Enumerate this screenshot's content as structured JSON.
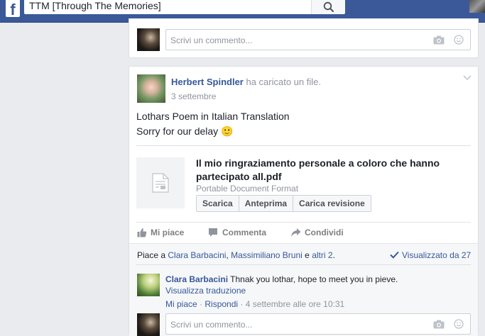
{
  "header": {
    "logo": "f",
    "search_value": "TTM [Through The Memories]",
    "search_icon": "search-icon"
  },
  "top_comment": {
    "placeholder": "Scrivi un commento...",
    "icons": [
      "camera-icon",
      "smiley-icon"
    ]
  },
  "post": {
    "author": "Herbert Spindler",
    "action": "ha caricato un file.",
    "date": "3 settembre",
    "text_line1": "Lothars Poem in Italian Translation",
    "text_line2": "Sorry for our delay",
    "emoji": "🙂",
    "attachment": {
      "title": "Il mio ringraziamento personale a coloro che hanno partecipato all.pdf",
      "type": "Portable Document Format",
      "buttons": [
        "Scarica",
        "Anteprima",
        "Carica revisione"
      ]
    },
    "actions": {
      "like": "Mi piace",
      "comment": "Commenta",
      "share": "Condividi"
    }
  },
  "social": {
    "likes_prefix": "Piace a",
    "liker1": "Clara Barbacini",
    "sep1": ",",
    "liker2": "Massimiliano Bruni",
    "sep2": "e",
    "liker3": "altri 2",
    "end": ".",
    "seen": "Visualizzato da 27"
  },
  "comment": {
    "author": "Clara Barbacini",
    "text": "Thnak you lothar, hope to meet you in pieve.",
    "translate": "Visualizza traduzione",
    "like": "Mi piace",
    "dot1": "·",
    "reply": "Rispondi",
    "dot2": "·",
    "time": "4 settembre alle ore 10:31"
  },
  "bottom_comment": {
    "placeholder": "Scrivi un commento..."
  },
  "colors": {
    "brand": "#3b5998",
    "link": "#365899",
    "background": "#e9ebee"
  }
}
